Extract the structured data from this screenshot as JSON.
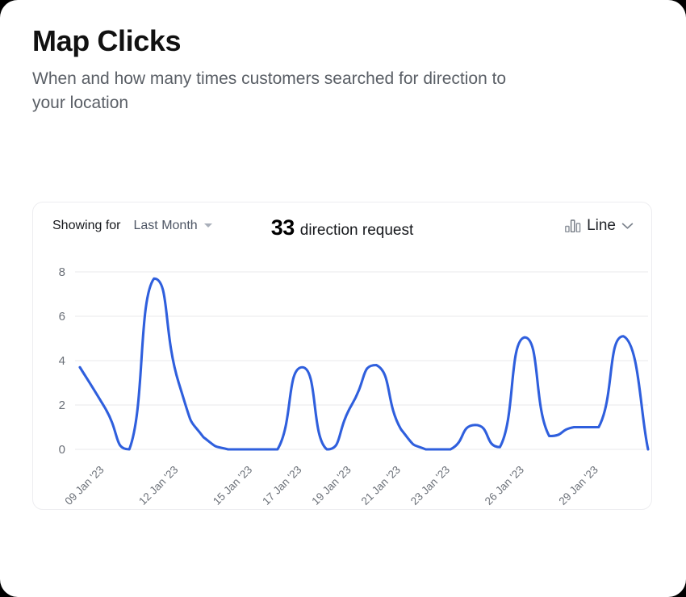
{
  "header": {
    "title": "Map Clicks",
    "subtitle": "When and how many times customers searched for direction to your location"
  },
  "card": {
    "showing_label": "Showing for",
    "range_value": "Last Month",
    "range_caret_icon": "chevron-down-icon",
    "stat_number": "33",
    "stat_text": "direction request",
    "chart_type_label": "Line",
    "chart_type_icon": "bar-chart-icon",
    "chart_type_caret_icon": "chevron-down-icon"
  },
  "colors": {
    "line": "#2f5fdd",
    "grid": "#f0f0f2",
    "tick_text": "#6b7078",
    "card_border": "#ededf0",
    "title": "#111111",
    "subtitle": "#5a5f66",
    "range_text": "#4d5564"
  },
  "chart_data": {
    "type": "line",
    "title": "Map Clicks",
    "xlabel": "",
    "ylabel": "",
    "ylim": [
      0,
      8
    ],
    "yticks": [
      0,
      2,
      4,
      6,
      8
    ],
    "grid": true,
    "legend": "none",
    "smooth": true,
    "categories": [
      "09 Jan '23",
      "12 Jan '23",
      "15 Jan '23",
      "17 Jan '23",
      "19 Jan '23",
      "21 Jan '23",
      "23 Jan '23",
      "26 Jan '23",
      "29 Jan '23"
    ],
    "xtick_positions": [
      1,
      4,
      7,
      9,
      11,
      13,
      15,
      18,
      21
    ],
    "series": [
      {
        "name": "Direction requests",
        "color": "#2f5fdd",
        "x": [
          0,
          1,
          2,
          3,
          4,
          5,
          6,
          7,
          8,
          9,
          10,
          11,
          12,
          13,
          14,
          15,
          16,
          17,
          18,
          19,
          20,
          21,
          22,
          23
        ],
        "values": [
          3.7,
          1.9,
          0,
          7.7,
          3.0,
          0.55,
          0,
          0,
          0,
          3.7,
          0,
          2.0,
          3.8,
          0.9,
          0,
          0,
          1.1,
          0.1,
          5.05,
          0.6,
          1.0,
          1.0,
          5.1,
          0
        ]
      }
    ],
    "total": 33,
    "total_unit": "direction request"
  }
}
